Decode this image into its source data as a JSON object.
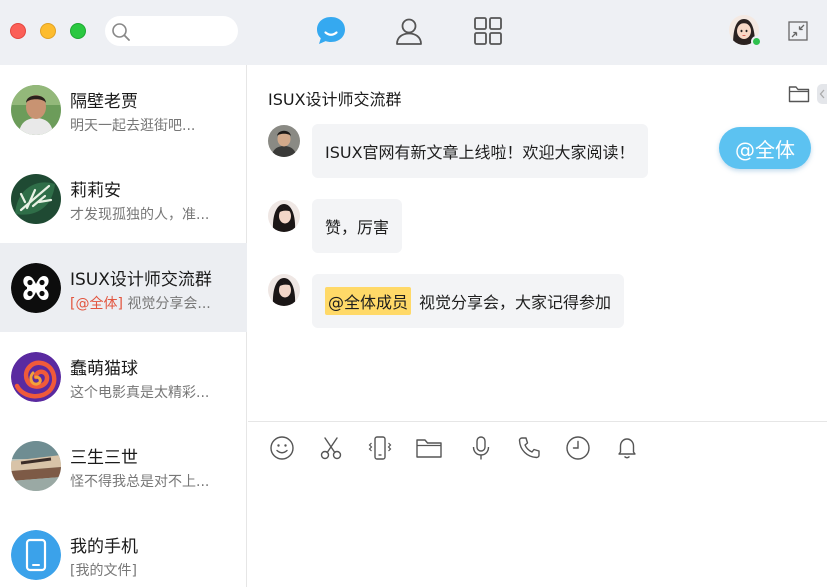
{
  "window": {
    "close_color": "#fb5f57",
    "minimize_color": "#fdbc2e",
    "zoom_color": "#2ac840"
  },
  "search": {
    "placeholder": "",
    "value": "",
    "icon": "search-icon"
  },
  "top_nav": {
    "active": "chat",
    "items": [
      {
        "id": "chat",
        "icon": "chat-bubble-icon",
        "color": "#35a9f0"
      },
      {
        "id": "contacts",
        "icon": "person-icon"
      },
      {
        "id": "apps",
        "icon": "grid-icon"
      }
    ]
  },
  "self": {
    "status": "online",
    "status_color": "#2fc14e"
  },
  "conversations": [
    {
      "name": "隔壁老贾",
      "preview": "明天一起去逛街吧...",
      "mention": "",
      "avatar": "man-photo-avatar"
    },
    {
      "name": "莉莉安",
      "preview": "才发现孤独的人，准...",
      "mention": "",
      "avatar": "leaf-avatar"
    },
    {
      "name": "ISUX设计师交流群",
      "preview": " 视觉分享会...",
      "mention": "[@全体]",
      "avatar": "isux-logo-avatar",
      "active": true
    },
    {
      "name": "蠢萌猫球",
      "preview": "这个电影真是太精彩...",
      "mention": "",
      "avatar": "spiral-avatar"
    },
    {
      "name": "三生三世",
      "preview": "怪不得我总是对不上...",
      "mention": "",
      "avatar": "blurry-photo-avatar"
    },
    {
      "name": "我的手机",
      "preview": "[我的文件]",
      "mention": "",
      "avatar": "phone-avatar"
    }
  ],
  "chat": {
    "title": "ISUX设计师交流群",
    "messages": [
      {
        "sender_avatar": "man-avatar",
        "text": "ISUX官网有新文章上线啦！欢迎大家阅读！"
      },
      {
        "sender_avatar": "woman-avatar",
        "text": "赞，厉害"
      },
      {
        "sender_avatar": "woman-avatar",
        "mention": "@全体成员",
        "text": "视觉分享会，大家记得参加"
      }
    ],
    "at_all_button": "@全体"
  },
  "toolbar": {
    "tools": [
      "emoji-icon",
      "scissors-icon",
      "shake-icon",
      "folder-icon",
      "microphone-icon",
      "phone-icon",
      "clock-icon",
      "bell-icon"
    ]
  },
  "composer": {
    "placeholder": "",
    "value": ""
  },
  "colors": {
    "accent": "#35a9f0",
    "mention_red": "#e2553f",
    "highlight_yellow": "#ffd968",
    "at_all_blue": "#5cc2f1"
  }
}
